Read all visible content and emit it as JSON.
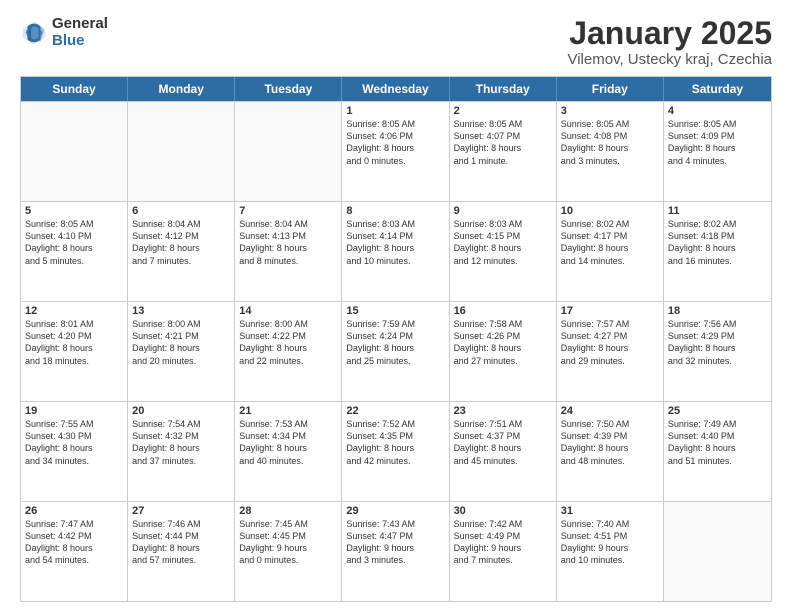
{
  "logo": {
    "general": "General",
    "blue": "Blue"
  },
  "title": "January 2025",
  "subtitle": "Vilemov, Ustecky kraj, Czechia",
  "header_days": [
    "Sunday",
    "Monday",
    "Tuesday",
    "Wednesday",
    "Thursday",
    "Friday",
    "Saturday"
  ],
  "weeks": [
    [
      {
        "day": "",
        "lines": [],
        "empty": true
      },
      {
        "day": "",
        "lines": [],
        "empty": true
      },
      {
        "day": "",
        "lines": [],
        "empty": true
      },
      {
        "day": "1",
        "lines": [
          "Sunrise: 8:05 AM",
          "Sunset: 4:06 PM",
          "Daylight: 8 hours",
          "and 0 minutes."
        ]
      },
      {
        "day": "2",
        "lines": [
          "Sunrise: 8:05 AM",
          "Sunset: 4:07 PM",
          "Daylight: 8 hours",
          "and 1 minute."
        ]
      },
      {
        "day": "3",
        "lines": [
          "Sunrise: 8:05 AM",
          "Sunset: 4:08 PM",
          "Daylight: 8 hours",
          "and 3 minutes."
        ]
      },
      {
        "day": "4",
        "lines": [
          "Sunrise: 8:05 AM",
          "Sunset: 4:09 PM",
          "Daylight: 8 hours",
          "and 4 minutes."
        ]
      }
    ],
    [
      {
        "day": "5",
        "lines": [
          "Sunrise: 8:05 AM",
          "Sunset: 4:10 PM",
          "Daylight: 8 hours",
          "and 5 minutes."
        ]
      },
      {
        "day": "6",
        "lines": [
          "Sunrise: 8:04 AM",
          "Sunset: 4:12 PM",
          "Daylight: 8 hours",
          "and 7 minutes."
        ]
      },
      {
        "day": "7",
        "lines": [
          "Sunrise: 8:04 AM",
          "Sunset: 4:13 PM",
          "Daylight: 8 hours",
          "and 8 minutes."
        ]
      },
      {
        "day": "8",
        "lines": [
          "Sunrise: 8:03 AM",
          "Sunset: 4:14 PM",
          "Daylight: 8 hours",
          "and 10 minutes."
        ]
      },
      {
        "day": "9",
        "lines": [
          "Sunrise: 8:03 AM",
          "Sunset: 4:15 PM",
          "Daylight: 8 hours",
          "and 12 minutes."
        ]
      },
      {
        "day": "10",
        "lines": [
          "Sunrise: 8:02 AM",
          "Sunset: 4:17 PM",
          "Daylight: 8 hours",
          "and 14 minutes."
        ]
      },
      {
        "day": "11",
        "lines": [
          "Sunrise: 8:02 AM",
          "Sunset: 4:18 PM",
          "Daylight: 8 hours",
          "and 16 minutes."
        ]
      }
    ],
    [
      {
        "day": "12",
        "lines": [
          "Sunrise: 8:01 AM",
          "Sunset: 4:20 PM",
          "Daylight: 8 hours",
          "and 18 minutes."
        ]
      },
      {
        "day": "13",
        "lines": [
          "Sunrise: 8:00 AM",
          "Sunset: 4:21 PM",
          "Daylight: 8 hours",
          "and 20 minutes."
        ]
      },
      {
        "day": "14",
        "lines": [
          "Sunrise: 8:00 AM",
          "Sunset: 4:22 PM",
          "Daylight: 8 hours",
          "and 22 minutes."
        ]
      },
      {
        "day": "15",
        "lines": [
          "Sunrise: 7:59 AM",
          "Sunset: 4:24 PM",
          "Daylight: 8 hours",
          "and 25 minutes."
        ]
      },
      {
        "day": "16",
        "lines": [
          "Sunrise: 7:58 AM",
          "Sunset: 4:26 PM",
          "Daylight: 8 hours",
          "and 27 minutes."
        ]
      },
      {
        "day": "17",
        "lines": [
          "Sunrise: 7:57 AM",
          "Sunset: 4:27 PM",
          "Daylight: 8 hours",
          "and 29 minutes."
        ]
      },
      {
        "day": "18",
        "lines": [
          "Sunrise: 7:56 AM",
          "Sunset: 4:29 PM",
          "Daylight: 8 hours",
          "and 32 minutes."
        ]
      }
    ],
    [
      {
        "day": "19",
        "lines": [
          "Sunrise: 7:55 AM",
          "Sunset: 4:30 PM",
          "Daylight: 8 hours",
          "and 34 minutes."
        ]
      },
      {
        "day": "20",
        "lines": [
          "Sunrise: 7:54 AM",
          "Sunset: 4:32 PM",
          "Daylight: 8 hours",
          "and 37 minutes."
        ]
      },
      {
        "day": "21",
        "lines": [
          "Sunrise: 7:53 AM",
          "Sunset: 4:34 PM",
          "Daylight: 8 hours",
          "and 40 minutes."
        ]
      },
      {
        "day": "22",
        "lines": [
          "Sunrise: 7:52 AM",
          "Sunset: 4:35 PM",
          "Daylight: 8 hours",
          "and 42 minutes."
        ]
      },
      {
        "day": "23",
        "lines": [
          "Sunrise: 7:51 AM",
          "Sunset: 4:37 PM",
          "Daylight: 8 hours",
          "and 45 minutes."
        ]
      },
      {
        "day": "24",
        "lines": [
          "Sunrise: 7:50 AM",
          "Sunset: 4:39 PM",
          "Daylight: 8 hours",
          "and 48 minutes."
        ]
      },
      {
        "day": "25",
        "lines": [
          "Sunrise: 7:49 AM",
          "Sunset: 4:40 PM",
          "Daylight: 8 hours",
          "and 51 minutes."
        ]
      }
    ],
    [
      {
        "day": "26",
        "lines": [
          "Sunrise: 7:47 AM",
          "Sunset: 4:42 PM",
          "Daylight: 8 hours",
          "and 54 minutes."
        ]
      },
      {
        "day": "27",
        "lines": [
          "Sunrise: 7:46 AM",
          "Sunset: 4:44 PM",
          "Daylight: 8 hours",
          "and 57 minutes."
        ]
      },
      {
        "day": "28",
        "lines": [
          "Sunrise: 7:45 AM",
          "Sunset: 4:45 PM",
          "Daylight: 9 hours",
          "and 0 minutes."
        ]
      },
      {
        "day": "29",
        "lines": [
          "Sunrise: 7:43 AM",
          "Sunset: 4:47 PM",
          "Daylight: 9 hours",
          "and 3 minutes."
        ]
      },
      {
        "day": "30",
        "lines": [
          "Sunrise: 7:42 AM",
          "Sunset: 4:49 PM",
          "Daylight: 9 hours",
          "and 7 minutes."
        ]
      },
      {
        "day": "31",
        "lines": [
          "Sunrise: 7:40 AM",
          "Sunset: 4:51 PM",
          "Daylight: 9 hours",
          "and 10 minutes."
        ]
      },
      {
        "day": "",
        "lines": [],
        "empty": true
      }
    ]
  ]
}
